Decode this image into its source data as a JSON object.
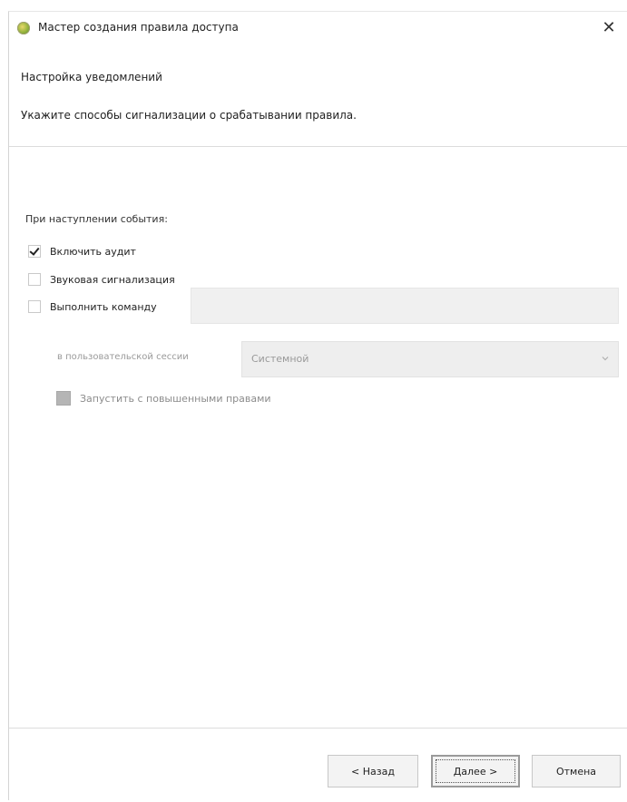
{
  "window": {
    "title": "Мастер создания правила доступа",
    "close_glyph": "✕"
  },
  "header": {
    "title": "Настройка уведомлений",
    "description": "Укажите способы сигнализации о срабатывании правила."
  },
  "form": {
    "group_label": "При наступлении события:",
    "enable_audit": {
      "label": "Включить аудит",
      "checked": true
    },
    "sound_alarm": {
      "label": "Звуковая сигнализация",
      "checked": false
    },
    "run_command": {
      "label": "Выполнить команду",
      "checked": false,
      "value": ""
    },
    "session": {
      "label": "в пользовательской сессии",
      "selected": "Системной"
    },
    "elevated": {
      "label": "Запустить с повышенными правами",
      "checked": false,
      "disabled": true
    }
  },
  "footer": {
    "back_label": "< Назад",
    "next_label": "Далее >",
    "cancel_label": "Отмена"
  }
}
